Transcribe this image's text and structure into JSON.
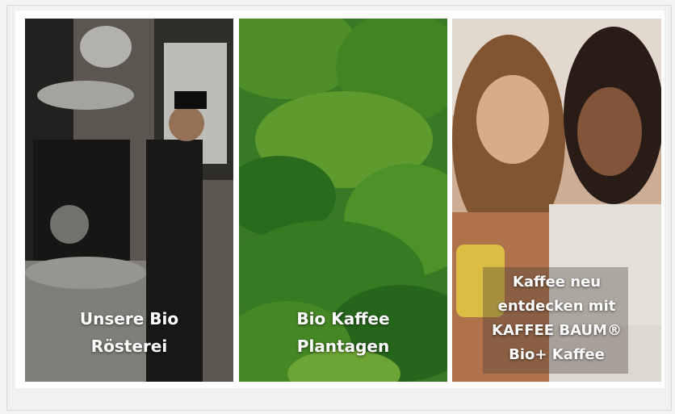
{
  "tiles": [
    {
      "caption": "Unsere Bio\nRösterei",
      "image": "coffee-roaster-photo"
    },
    {
      "caption": "Bio Kaffee\nPlantagen",
      "image": "coffee-plantation-photo"
    },
    {
      "caption": "Kaffee neu\nentdecken mit\nKAFFEE BAUM®\nBio+ Kaffee",
      "image": "two-women-smartphone-photo"
    }
  ],
  "colors": {
    "page_background": "#f3f3f3",
    "caption_text": "#ffffff"
  }
}
